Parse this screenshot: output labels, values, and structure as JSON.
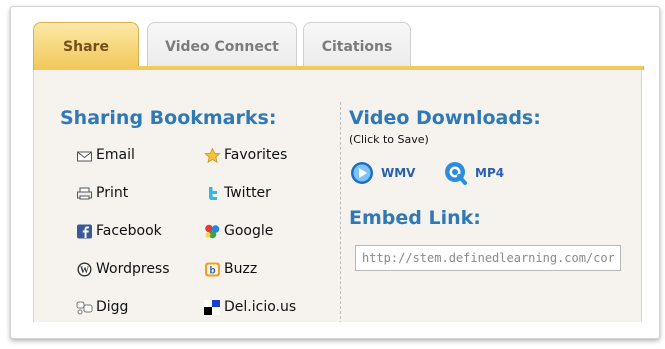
{
  "tabs": [
    {
      "label": "Share"
    },
    {
      "label": "Video Connect"
    },
    {
      "label": "Citations"
    }
  ],
  "sharing": {
    "heading": "Sharing Bookmarks:",
    "left_items": [
      {
        "label": "Email",
        "icon": "envelope-icon"
      },
      {
        "label": "Print",
        "icon": "printer-icon"
      },
      {
        "label": "Facebook",
        "icon": "facebook-icon"
      },
      {
        "label": "Wordpress",
        "icon": "wordpress-icon"
      },
      {
        "label": "Digg",
        "icon": "digg-icon"
      }
    ],
    "right_items": [
      {
        "label": "Favorites",
        "icon": "star-icon"
      },
      {
        "label": "Twitter",
        "icon": "twitter-icon"
      },
      {
        "label": "Google",
        "icon": "google-icon"
      },
      {
        "label": "Buzz",
        "icon": "buzz-icon"
      },
      {
        "label": "Del.icio.us",
        "icon": "delicious-icon"
      }
    ]
  },
  "video": {
    "heading": "Video Downloads:",
    "subheading": "(Click to Save)",
    "downloads": [
      {
        "label": "WMV",
        "icon": "windows-media-icon"
      },
      {
        "label": "MP4",
        "icon": "quicktime-icon"
      }
    ]
  },
  "embed": {
    "heading": "Embed Link:",
    "value": "http://stem.definedlearning.com/cor"
  },
  "colors": {
    "accent_blue": "#2f7ab6",
    "active_tab": "#f2c95c",
    "panel_bg": "#f6f3ee"
  }
}
